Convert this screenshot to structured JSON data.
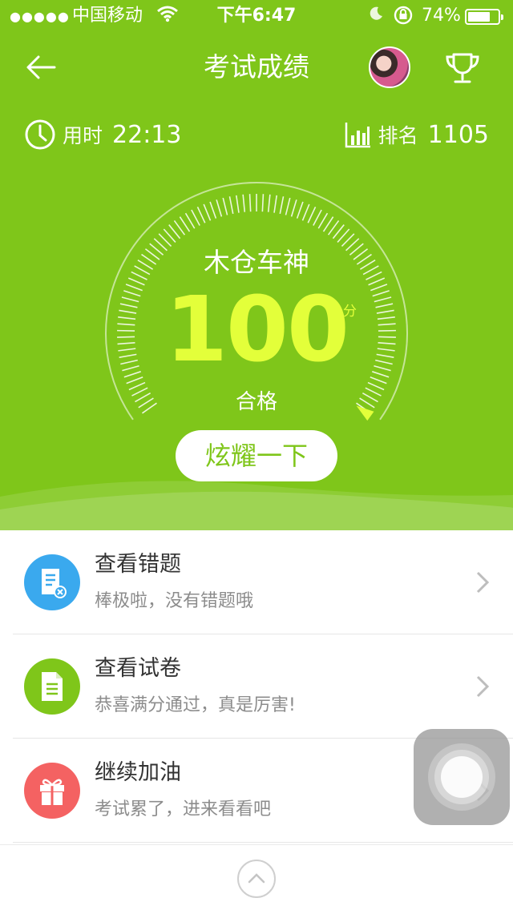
{
  "status_bar": {
    "signal": "●●●●●",
    "carrier": "中国移动",
    "time": "下午6:47",
    "battery_percent": "74%",
    "battery_level": 0.74
  },
  "header": {
    "title": "考试成绩",
    "back_icon": "arrow-left-icon",
    "trophy_icon": "trophy-icon"
  },
  "stats": {
    "time_label": "用时",
    "time_value": "22:13",
    "rank_label": "排名",
    "rank_value": "1105"
  },
  "result": {
    "title": "木仓车神",
    "score": "100",
    "score_unit": "分",
    "status": "合格",
    "share_label": "炫耀一下"
  },
  "actions": [
    {
      "title": "查看错题",
      "subtitle": "棒极啦，没有错题哦",
      "icon": "wrong-questions-icon",
      "color": "#3aa9ee"
    },
    {
      "title": "查看试卷",
      "subtitle": "恭喜满分通过，真是厉害!",
      "icon": "exam-paper-icon",
      "color": "#7fc61a"
    },
    {
      "title": "继续加油",
      "subtitle": "考试累了，进来看看吧",
      "icon": "gift-icon",
      "color": "#f46262"
    }
  ],
  "colors": {
    "brand_green": "#7fc61a",
    "score_yellow": "#e3ff3a"
  }
}
